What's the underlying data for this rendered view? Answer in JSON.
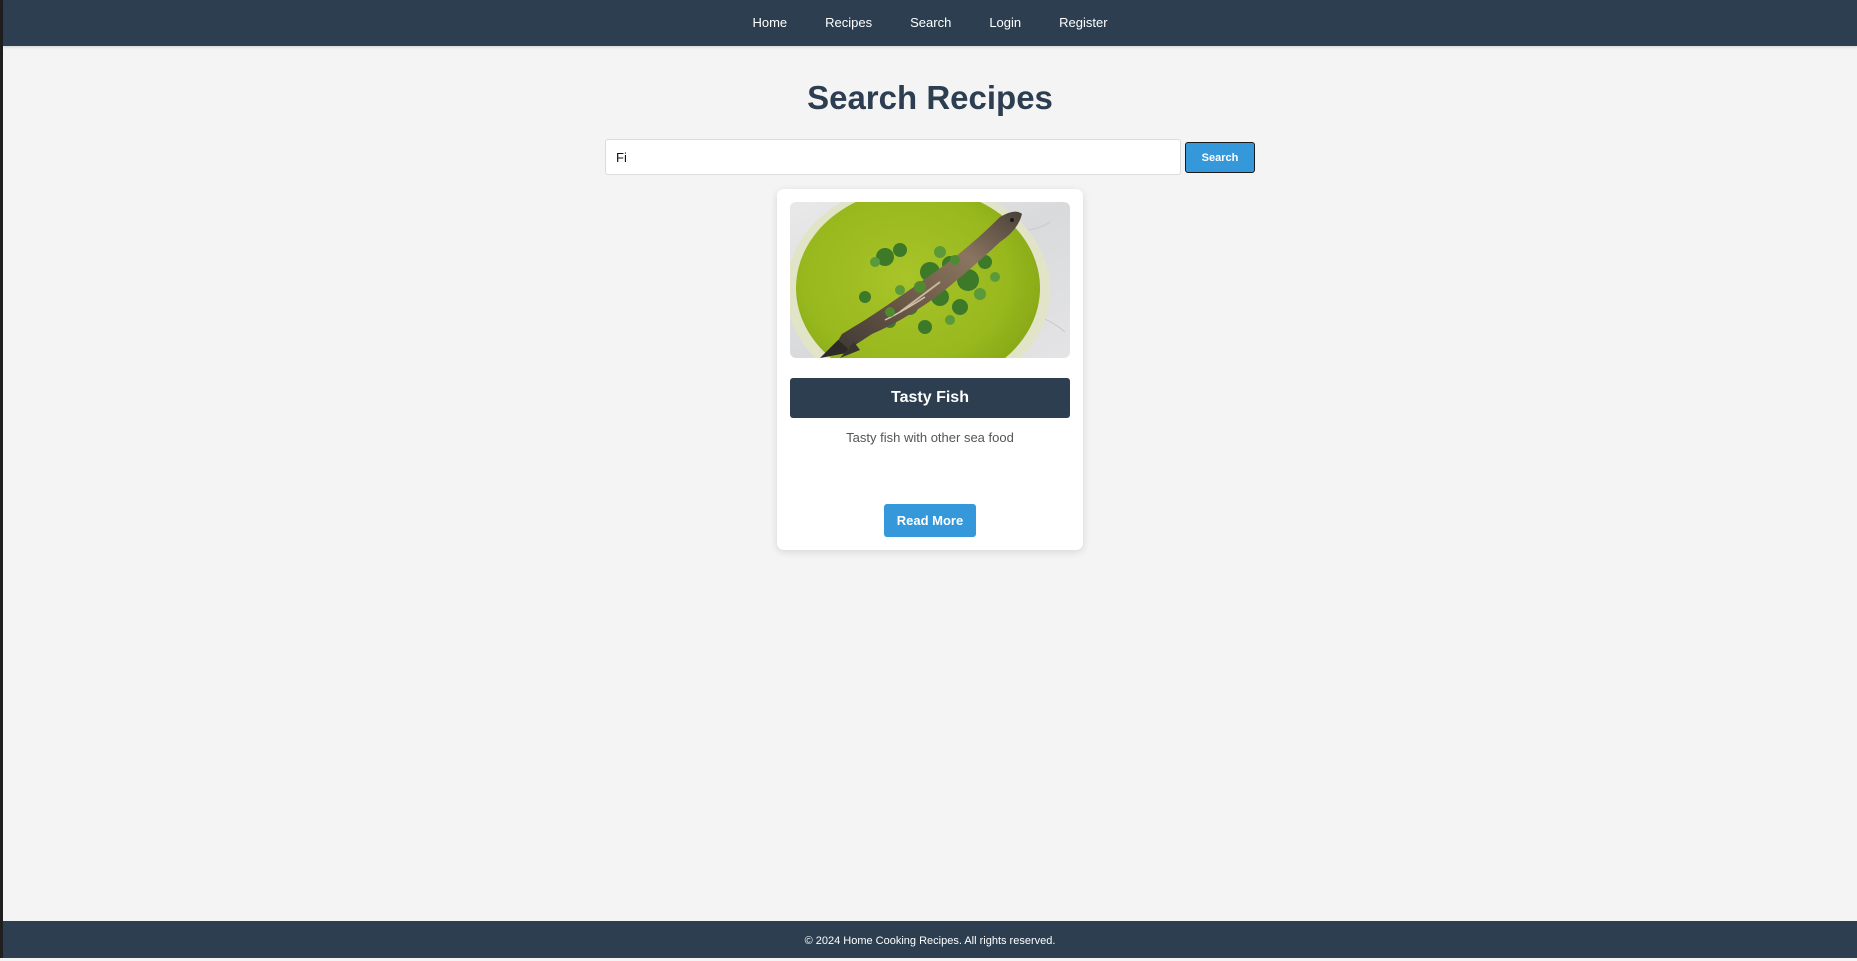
{
  "nav": {
    "items": [
      {
        "label": "Home"
      },
      {
        "label": "Recipes"
      },
      {
        "label": "Search"
      },
      {
        "label": "Login"
      },
      {
        "label": "Register"
      }
    ]
  },
  "page": {
    "title": "Search Recipes"
  },
  "search": {
    "value": "Fi",
    "button_label": "Search"
  },
  "results": [
    {
      "title": "Tasty Fish",
      "description": "Tasty fish with other sea food",
      "image_icon": "fish-dish-photo",
      "button_label": "Read More"
    }
  ],
  "footer": {
    "text": "© 2024 Home Cooking Recipes. All rights reserved."
  },
  "colors": {
    "nav_bg": "#2c3e50",
    "accent": "#3498db",
    "page_bg": "#f4f4f4",
    "title": "#2c3e50"
  }
}
